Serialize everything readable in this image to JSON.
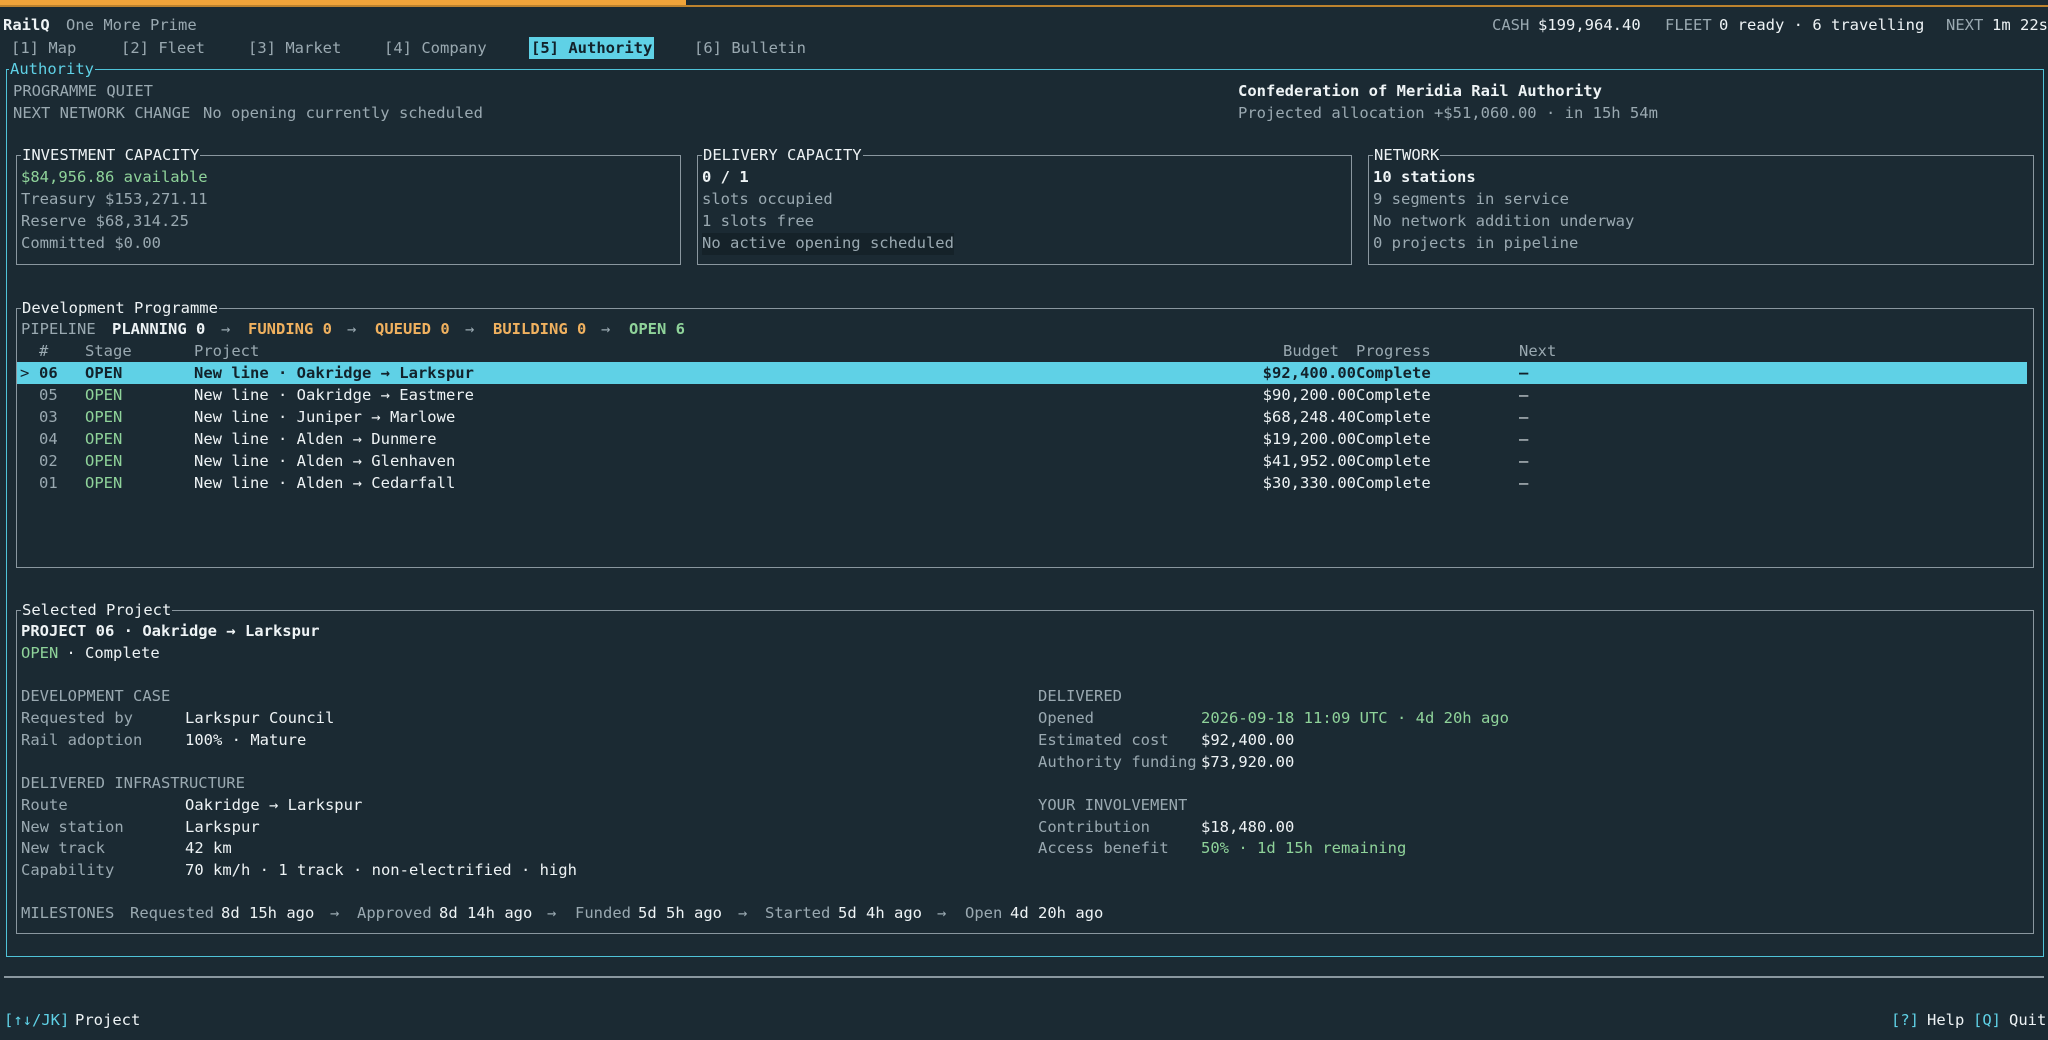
{
  "header": {
    "app_name": "RailQ",
    "subtitle": "One More Prime",
    "cash_label": "CASH",
    "cash_value": "$199,964.40",
    "fleet_label": "FLEET",
    "fleet_value": "0 ready · 6 travelling",
    "next_label": "NEXT",
    "next_value": "1m 22s",
    "progress_fraction": 0.335
  },
  "tabs": [
    {
      "label": "[1] Map"
    },
    {
      "label": "[2] Fleet"
    },
    {
      "label": "[3] Market"
    },
    {
      "label": "[4] Company"
    },
    {
      "label": "[5] Authority"
    },
    {
      "label": "[6] Bulletin"
    }
  ],
  "authority": {
    "title": "Authority",
    "programme_status": "PROGRAMME QUIET",
    "next_change_label": "NEXT NETWORK CHANGE",
    "next_change_value": "No opening currently scheduled",
    "org_name": "Confederation of Meridia Rail Authority",
    "allocation": "Projected allocation +$51,060.00 · in 15h 54m"
  },
  "investment": {
    "title": "INVESTMENT CAPACITY",
    "available": "$84,956.86 available",
    "treasury": "Treasury $153,271.11",
    "reserve": "Reserve $68,314.25",
    "committed": "Committed $0.00"
  },
  "delivery": {
    "title": "DELIVERY CAPACITY",
    "slots": "0 / 1",
    "occupied": "slots occupied",
    "free": "1 slots free",
    "status": "No active opening scheduled"
  },
  "network": {
    "title": "NETWORK",
    "stations": "10 stations",
    "segments": "9 segments in service",
    "addition": "No network addition underway",
    "projects": "0 projects in pipeline"
  },
  "programme": {
    "title": "Development Programme",
    "pipeline_label": "PIPELINE",
    "planning": "PLANNING 0",
    "funding": "FUNDING 0",
    "queued": "QUEUED 0",
    "building": "BUILDING 0",
    "open": "OPEN 6",
    "arrow": "→",
    "columns": {
      "num": "#",
      "stage": "Stage",
      "project": "Project",
      "budget": "Budget",
      "progress": "Progress",
      "next": "Next"
    },
    "rows": [
      {
        "marker": ">",
        "num": "06",
        "stage": "OPEN",
        "project": "New line · Oakridge → Larkspur",
        "budget": "$92,400.00",
        "progress": "Complete",
        "next": "—"
      },
      {
        "marker": "",
        "num": "05",
        "stage": "OPEN",
        "project": "New line · Oakridge → Eastmere",
        "budget": "$90,200.00",
        "progress": "Complete",
        "next": "—"
      },
      {
        "marker": "",
        "num": "03",
        "stage": "OPEN",
        "project": "New line · Juniper → Marlowe",
        "budget": "$68,248.40",
        "progress": "Complete",
        "next": "—"
      },
      {
        "marker": "",
        "num": "04",
        "stage": "OPEN",
        "project": "New line · Alden → Dunmere",
        "budget": "$19,200.00",
        "progress": "Complete",
        "next": "—"
      },
      {
        "marker": "",
        "num": "02",
        "stage": "OPEN",
        "project": "New line · Alden → Glenhaven",
        "budget": "$41,952.00",
        "progress": "Complete",
        "next": "—"
      },
      {
        "marker": "",
        "num": "01",
        "stage": "OPEN",
        "project": "New line · Alden → Cedarfall",
        "budget": "$30,330.00",
        "progress": "Complete",
        "next": "—"
      }
    ]
  },
  "selected": {
    "title": "Selected Project",
    "heading": "PROJECT 06 · Oakridge → Larkspur",
    "stage": "OPEN",
    "status": " · Complete",
    "dev_case_title": "DEVELOPMENT CASE",
    "requested_by_label": "Requested by",
    "requested_by": "Larkspur Council",
    "adoption_label": "Rail adoption",
    "adoption": "100% · Mature",
    "infra_title": "DELIVERED INFRASTRUCTURE",
    "route_label": "Route",
    "route": "Oakridge → Larkspur",
    "station_label": "New station",
    "station": "Larkspur",
    "track_label": "New track",
    "track": "42 km",
    "capability_label": "Capability",
    "capability": "70 km/h · 1 track · non-electrified · high",
    "delivered_title": "DELIVERED",
    "opened_label": "Opened",
    "opened": "2026-09-18 11:09 UTC · 4d 20h ago",
    "est_cost_label": "Estimated cost",
    "est_cost": "$92,400.00",
    "funding_label": "Authority funding",
    "funding": "$73,920.00",
    "involvement_title": "YOUR INVOLVEMENT",
    "contribution_label": "Contribution",
    "contribution": "$18,480.00",
    "access_label": "Access benefit",
    "access": "50% · 1d 15h remaining",
    "milestones_label": "MILESTONES",
    "milestones": [
      {
        "label": "Requested",
        "value": "8d 15h ago"
      },
      {
        "label": "Approved",
        "value": "8d 14h ago"
      },
      {
        "label": "Funded",
        "value": "5d 5h ago"
      },
      {
        "label": "Started",
        "value": "5d 4h ago"
      },
      {
        "label": "Open",
        "value": "4d 20h ago"
      }
    ]
  },
  "footer": {
    "keys": "[↑↓/JK]",
    "keys_label": "Project",
    "help_key": "[?]",
    "help_label": "Help",
    "quit_key": "[Q]",
    "quit_label": "Quit"
  }
}
